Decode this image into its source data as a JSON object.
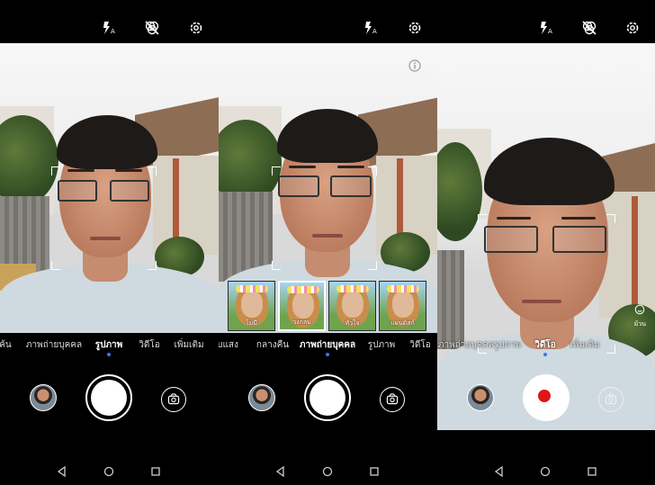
{
  "topbar": {
    "icons": [
      "flash-auto-icon",
      "filter-off-icon",
      "settings-gear-icon"
    ]
  },
  "screens": [
    {
      "modes": [
        "ค้น",
        "ภาพถ่ายบุคคล",
        "รูปภาพ",
        "วิดีโอ",
        "เพิ่มเติม"
      ],
      "active_mode": "รูปภาพ"
    },
    {
      "modes": [
        "ับแสง",
        "กลางคืน",
        "ภาพถ่ายบุคคล",
        "รูปภาพ",
        "วิดีโอ"
      ],
      "active_mode": "ภาพถ่ายบุคคล",
      "filters": [
        {
          "label": "ไม่มี",
          "selected": false
        },
        {
          "label": "วงกลม",
          "selected": true
        },
        {
          "label": "หัวใจ",
          "selected": false
        },
        {
          "label": "แผ่นดิสก์",
          "selected": false
        }
      ]
    },
    {
      "modes": [
        "ภาพถ่ายบุคคล",
        "รูปภาพ",
        "วิดีโอ",
        "เพิ่มเติม"
      ],
      "active_mode": "วิดีโอ",
      "sticker_label": "ม้วน"
    }
  ],
  "navbar": {
    "icons": [
      "back-triangle-icon",
      "home-circle-icon",
      "recents-square-icon"
    ]
  },
  "colors": {
    "accent_dot": "#2f7bff",
    "record": "#e01515"
  }
}
